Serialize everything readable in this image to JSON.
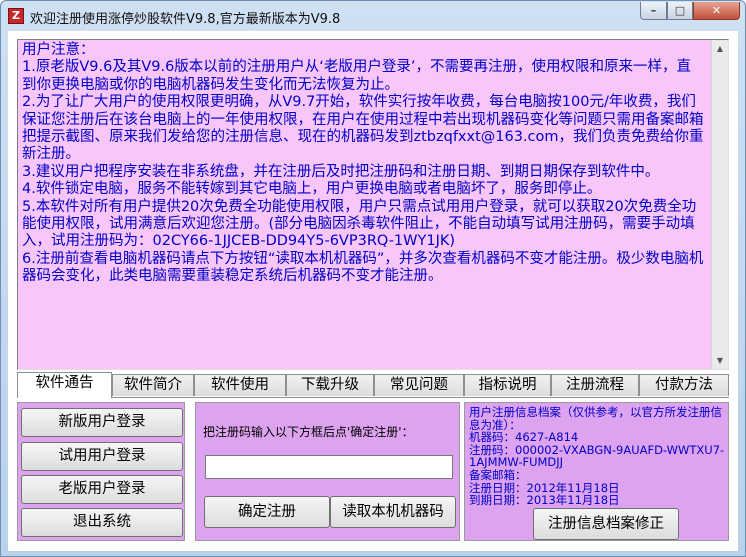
{
  "window": {
    "title": "欢迎注册使用涨停炒股软件V9.8,官方最新版本为V9.8",
    "icon": "app-logo-icon",
    "controls": {
      "minimize": "–",
      "maximize": "□",
      "close": "✕"
    }
  },
  "notice": {
    "text": "用户注意：\n1.原老版V9.6及其V9.6版本以前的注册用户从‘老版用户登录’，不需要再注册，使用权限和原来一样，直到你更换电脑或你的电脑机器码发生变化而无法恢复为止。\n2.为了让广大用户的使用权限更明确，从V9.7开始，软件实行按年收费，每台电脑按100元/年收费，我们保证您注册后在该台电脑上的一年使用权限，在用户在使用过程中若出现机器码变化等问题只需用备案邮箱把提示截图、原来我们发给您的注册信息、现在的机器码发到ztbzqfxxt@163.com，我们负责免费给你重新注册。\n3.建议用户把程序安装在非系统盘，并在注册后及时把注册码和注册日期、到期日期保存到软件中。\n4.软件锁定电脑，服务不能转嫁到其它电脑上，用户更换电脑或者电脑坏了，服务即停止。\n5.本软件对所有用户提供20次免费全功能使用权限，用户只需点试用用户登录，就可以获取20次免费全功能使用权限，试用满意后欢迎您注册。(部分电脑因杀毒软件阻止，不能自动填写试用注册码，需要手动填入，试用注册码为：02CY66-1JJCEB-DD94Y5-6VP3RQ-1WY1JK)\n6.注册前查看电脑机器码请点下方按钮“读取本机机器码”，并多次查看机器码不变才能注册。极少数电脑机器码会变化，此类电脑需要重装稳定系统后机器码不变才能注册。"
  },
  "tabs": [
    {
      "label": "软件通告",
      "active": true
    },
    {
      "label": "软件简介",
      "active": false
    },
    {
      "label": "软件使用",
      "active": false
    },
    {
      "label": "下载升级",
      "active": false
    },
    {
      "label": "常见问题",
      "active": false
    },
    {
      "label": "指标说明",
      "active": false
    },
    {
      "label": "注册流程",
      "active": false
    },
    {
      "label": "付款方法",
      "active": false
    }
  ],
  "login_buttons": {
    "new_user": "新版用户登录",
    "trial_user": "试用用户登录",
    "old_user": "老版用户登录",
    "exit": "退出系统"
  },
  "registration": {
    "prompt": "把注册码输入以下方框后点'确定注册'：",
    "code_value": "",
    "confirm_label": "确定注册",
    "read_machine_code_label": "读取本机机器码"
  },
  "user_info": {
    "text": "用户注册信息档案（仅供参考，以官方所发注册信息为准）：\n机器码：4627-A814\n注册码：000002-VXABGN-9AUAFD-WWTXU7-1AJMMW-FUMDJJ\n备案邮箱：\n注册日期：2012年11月18日\n到期日期：2013年11月18日",
    "fix_button_label": "注册信息档案修正"
  },
  "colors": {
    "notice_bg": "#f8c6f8",
    "text_blue": "#0000c8",
    "panel_bg": "#dda3ef"
  }
}
